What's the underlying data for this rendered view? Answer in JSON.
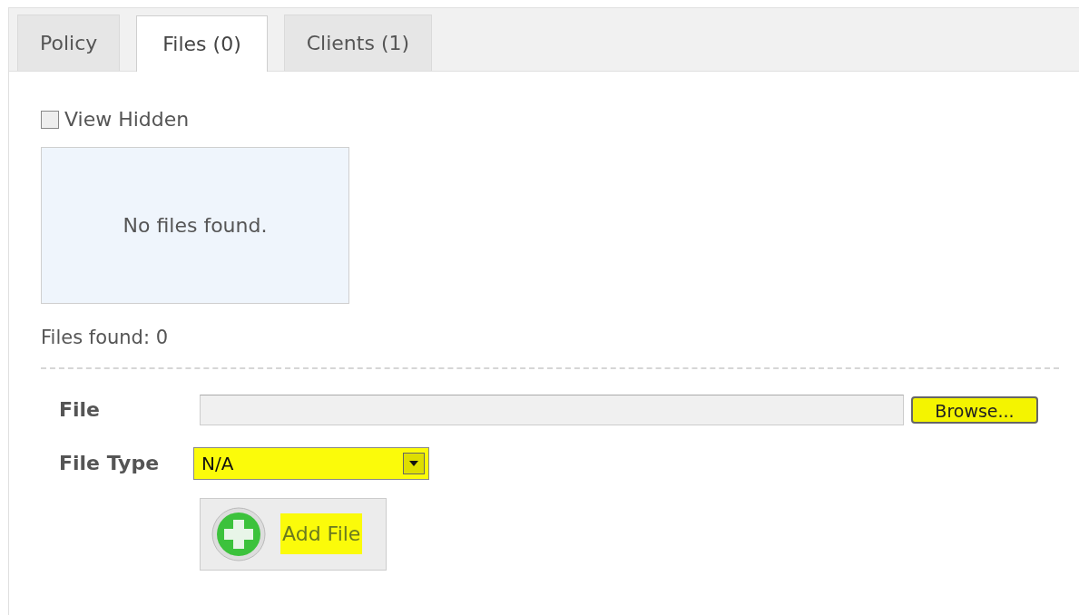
{
  "tabs": [
    {
      "label": "Policy",
      "selected": false
    },
    {
      "label": "Files (0)",
      "selected": true
    },
    {
      "label": "Clients (1)",
      "selected": false
    }
  ],
  "view_hidden": {
    "label": "View Hidden",
    "checked": false
  },
  "file_list": {
    "empty_message": "No files found."
  },
  "files_found": "Files found: 0",
  "form": {
    "file_label": "File",
    "browse_button": {
      "label": "Browse...",
      "highlighted": true
    },
    "file_type_label": "File Type",
    "file_type": {
      "value": "N/A",
      "highlighted": true
    },
    "add_button": {
      "label": "Add File",
      "highlighted": true
    }
  }
}
